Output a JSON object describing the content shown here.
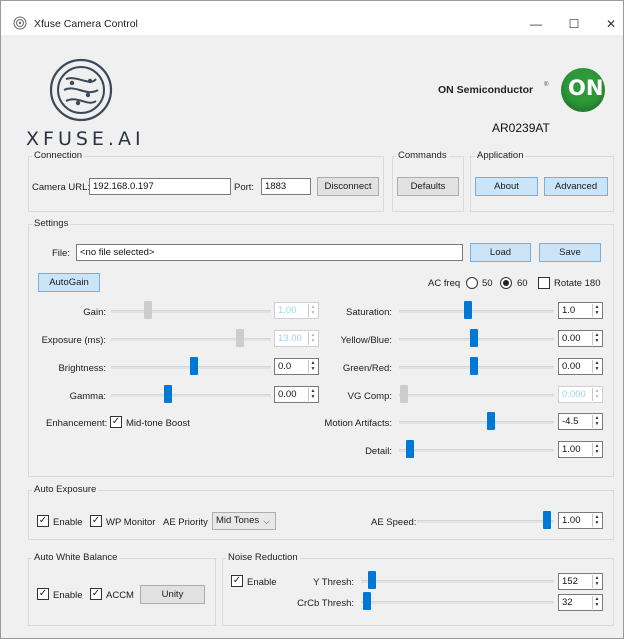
{
  "window": {
    "title": "Xfuse Camera Control",
    "minimize": "—",
    "maximize": "☐",
    "close": "✕"
  },
  "branding": {
    "xfuse_text": "XFUSE.AI",
    "on_semi": "ON Semiconductor",
    "on_logo_text": "ON",
    "model": "AR0239AT"
  },
  "connection": {
    "title": "Connection",
    "url_label": "Camera URL:",
    "url_value": "192.168.0.197",
    "port_label": "Port:",
    "port_value": "1883",
    "disconnect": "Disconnect"
  },
  "commands": {
    "title": "Commands",
    "defaults": "Defaults"
  },
  "application": {
    "title": "Application",
    "about": "About",
    "advanced": "Advanced"
  },
  "settings": {
    "title": "Settings",
    "file_label": "File:",
    "file_value": "<no file selected>",
    "load": "Load",
    "save": "Save",
    "autogain": "AutoGain",
    "acfreq_label": "AC freq",
    "freq50": "50",
    "freq60": "60",
    "freq_selected": "60",
    "rotate": "Rotate 180",
    "enhancement_label": "Enhancement:",
    "midtone_boost": "Mid-tone Boost",
    "left_sliders": [
      {
        "label": "Gain:",
        "value": "1.00",
        "level": 0.22,
        "disabled": true
      },
      {
        "label": "Exposure (ms):",
        "value": "13.00",
        "level": 0.82,
        "disabled": true
      },
      {
        "label": "Brightness:",
        "value": "0.0",
        "level": 0.52,
        "disabled": false
      },
      {
        "label": "Gamma:",
        "value": "0.00",
        "level": 0.35,
        "disabled": false
      }
    ],
    "right_sliders": [
      {
        "label": "Saturation:",
        "value": "1.0",
        "level": 0.44,
        "disabled": false
      },
      {
        "label": "Yellow/Blue:",
        "value": "0.00",
        "level": 0.48,
        "disabled": false
      },
      {
        "label": "Green/Red:",
        "value": "0.00",
        "level": 0.48,
        "disabled": false
      },
      {
        "label": "VG Comp:",
        "value": "0.000",
        "level": 0.01,
        "disabled": true
      },
      {
        "label": "Motion Artifacts:",
        "value": "-4.5",
        "level": 0.6,
        "disabled": false
      },
      {
        "label": "Detail:",
        "value": "1.00",
        "level": 0.05,
        "disabled": false
      }
    ]
  },
  "auto_exposure": {
    "title": "Auto Exposure",
    "enable": "Enable",
    "wp_monitor": "WP Monitor",
    "ae_priority_label": "AE Priority",
    "ae_priority_value": "Mid Tones",
    "ae_speed_label": "AE Speed:",
    "ae_speed_value": "1.00",
    "ae_speed_level": 0.98
  },
  "auto_white_balance": {
    "title": "Auto White Balance",
    "enable": "Enable",
    "accm": "ACCM",
    "unity": "Unity"
  },
  "noise_reduction": {
    "title": "Noise Reduction",
    "enable": "Enable",
    "y_thresh_label": "Y Thresh:",
    "y_thresh_value": "152",
    "y_thresh_level": 0.04,
    "crcb_thresh_label": "CrCb Thresh:",
    "crcb_thresh_value": "32",
    "crcb_thresh_level": 0.01
  },
  "colors": {
    "accent": "#0078d7",
    "on_logo": "#2e9a3a",
    "button_blue": "#cce4f7"
  }
}
